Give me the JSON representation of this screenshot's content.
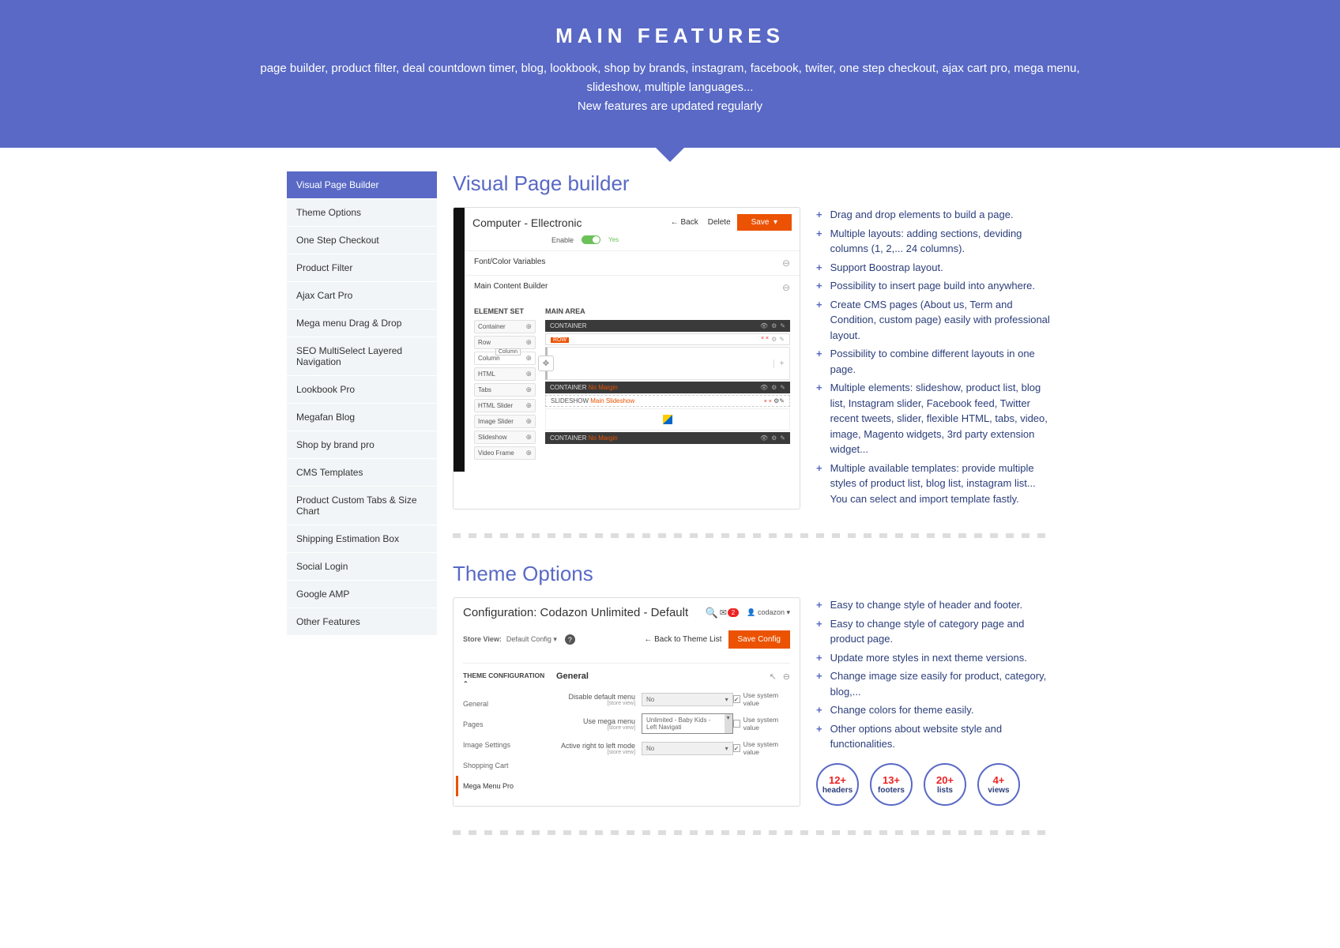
{
  "hero": {
    "title": "MAIN FEATURES",
    "line1": "page builder, product filter, deal countdown timer, blog, lookbook, shop by brands, instagram, facebook, twiter, one step checkout, ajax cart pro, mega menu, slideshow, multiple languages...",
    "line2": "New features are updated regularly"
  },
  "sidebar": [
    "Visual Page Builder",
    "Theme Options",
    "One Step Checkout",
    "Product Filter",
    "Ajax Cart Pro",
    "Mega menu Drag & Drop",
    "SEO MultiSelect Layered Navigation",
    "Lookbook Pro",
    "Megafan Blog",
    "Shop by brand pro",
    "CMS Templates",
    "Product Custom Tabs & Size Chart",
    "Shipping Estimation Box",
    "Social Login",
    "Google AMP",
    "Other Features"
  ],
  "vpb": {
    "title": "Visual Page builder",
    "features": [
      "Drag and drop elements to build a page.",
      "Multiple layouts: adding sections, deviding columns (1, 2,... 24 columns).",
      "Support Boostrap layout.",
      "Possibility to insert page build into anywhere.",
      "Create CMS pages (About us, Term and Condition, custom page) easily with professional layout.",
      "Possibility to combine different layouts in one page.",
      "Multiple elements: slideshow, product list, blog list, Instagram slider, Facebook feed, Twitter recent tweets, slider, flexible HTML, tabs, video, image, Magento widgets, 3rd party extension widget...",
      "Multiple available templates: provide multiple styles of product list, blog list, instagram list... You can select and import template fastly."
    ],
    "shot": {
      "title": "Computer - Ellectronic",
      "back": "Back",
      "delete": "Delete",
      "save": "Save",
      "enable": "Enable",
      "yes": "Yes",
      "panel1": "Font/Color Variables",
      "panel2": "Main Content Builder",
      "elset": "ELEMENT SET",
      "mainarea": "MAIN AREA",
      "els": [
        "Container",
        "Row",
        "Column",
        "HTML",
        "Tabs",
        "HTML Slider",
        "Image Slider",
        "Slideshow",
        "Video Frame"
      ],
      "colBadge": "Column",
      "container": "CONTAINER",
      "row": "ROW",
      "nomargin": "No Margin",
      "slideshow": "SLIDESHOW",
      "slideshowLabel": "Main Slideshow"
    }
  },
  "theme": {
    "title": "Theme Options",
    "features": [
      "Easy to change style of header and footer.",
      "Easy to change style of category page and product page.",
      "Update more styles in next theme versions.",
      "Change image size easily for product, category, blog,...",
      "Change colors for theme easily.",
      "Other options about website style and functionalities."
    ],
    "shot": {
      "title": "Configuration: Codazon Unlimited - Default",
      "bell": "2",
      "user": "codazon",
      "storeView": "Store View:",
      "defaultConfig": "Default Config",
      "back": "Back to Theme List",
      "saveConfig": "Save Config",
      "navhd": "THEME CONFIGURATION",
      "nav": [
        "General",
        "Pages",
        "Image Settings",
        "Shopping Cart",
        "Mega Menu Pro"
      ],
      "general": "General",
      "fields": {
        "disable": "Disable default menu",
        "usemega": "Use mega menu",
        "rtl": "Active right to left mode",
        "storeview": "[store view]",
        "no": "No",
        "megaval": "Unlimited - Baby Kids - Left Navigati",
        "usesys": "Use system value"
      }
    },
    "badges": [
      {
        "num": "12+",
        "lab": "headers"
      },
      {
        "num": "13+",
        "lab": "footers"
      },
      {
        "num": "20+",
        "lab": "lists"
      },
      {
        "num": "4+",
        "lab": "views"
      }
    ]
  }
}
